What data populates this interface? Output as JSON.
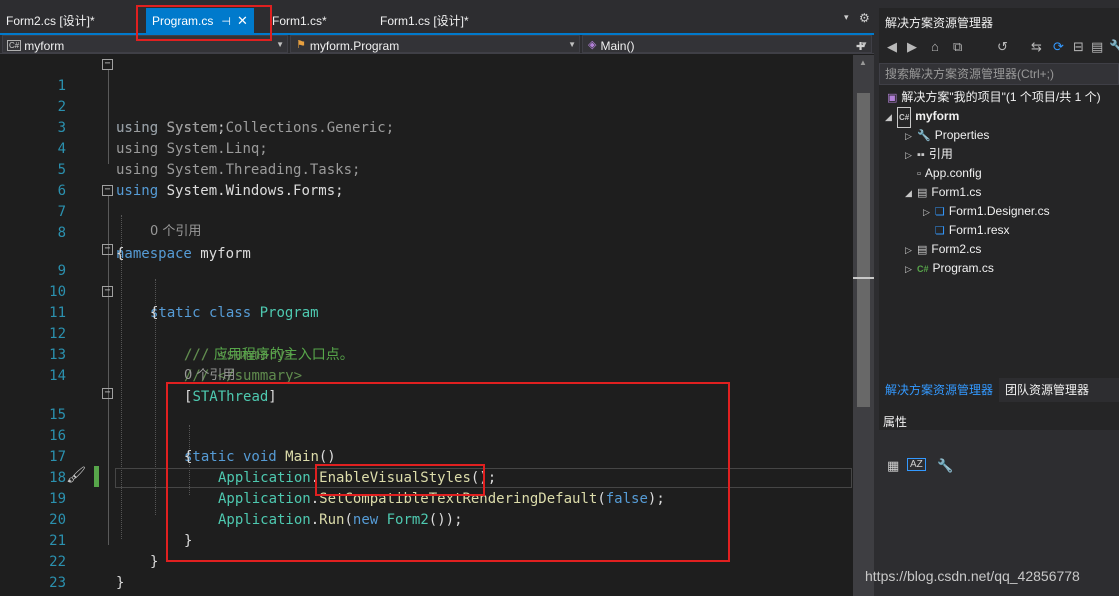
{
  "tabs": {
    "tab1": "Form2.cs [设计]*",
    "tab2": "Program.cs",
    "tab2_pin": "⊣",
    "tab2_close": "✕",
    "tab3": "Form1.cs*",
    "tab4": "Form1.cs [设计]*",
    "dropdown_icon": "▾",
    "gear_icon": "⚙"
  },
  "navbar": {
    "project": "myform",
    "project_badge": "C#",
    "class": "myform.Program",
    "member": "Main()"
  },
  "code": {
    "ln": [
      "1",
      "2",
      "3",
      "4",
      "5",
      "6",
      "7",
      "8",
      "9",
      "10",
      "11",
      "12",
      "13",
      "14",
      "15",
      "16",
      "17",
      "18",
      "19",
      "20",
      "21",
      "22",
      "23"
    ],
    "line1": {
      "kw": "using",
      "rest": " System;"
    },
    "line2": {
      "kw": "using",
      "rest": " System.Collections.Generic;"
    },
    "line3": {
      "kw": "using",
      "rest": " System.Linq;"
    },
    "line4": {
      "kw": "using",
      "rest": " System.Threading.Tasks;"
    },
    "line5": {
      "kw": "using",
      "rest": " System.Windows.Forms;"
    },
    "line7": {
      "kw": "namespace",
      "rest": " myform"
    },
    "line8": "{",
    "codelens1": "0 个引用",
    "line9": {
      "kw": "static class",
      "type": "Program"
    },
    "line10": "{",
    "line11": {
      "slashes": "///",
      "tag": " <summary>"
    },
    "line12": {
      "slashes": "///",
      "text": " 应用程序的主入口点。"
    },
    "line13": {
      "slashes": "///",
      "tag": " </summary>"
    },
    "line14": {
      "open": "[",
      "attr": "STAThread",
      "close": "]"
    },
    "codelens2": "0 个引用",
    "line15": {
      "kw": "static void",
      "fn": "Main",
      "rest": "()"
    },
    "line16": "{",
    "line17": {
      "type": "Application",
      "dot": ".",
      "fn": "EnableVisualStyles",
      "rest": "();"
    },
    "line18": {
      "type": "Application",
      "dot": ".",
      "fn": "SetCompatibleTextRenderingDefault",
      "open": "(",
      "kw": "false",
      "rest": ");"
    },
    "line19": {
      "type": "Application",
      "dot": ".",
      "fn": "Run",
      "open": "(",
      "kw": "new",
      "type2": "Form2",
      "rest": "());"
    },
    "line20": "}",
    "line21": "}",
    "line22": "}",
    "fold_minus": "−"
  },
  "scrollbar": {
    "up_arrow": "▲",
    "splitter": "✚"
  },
  "solution_explorer": {
    "title": "解决方案资源管理器",
    "search_placeholder": "搜索解决方案资源管理器(Ctrl+;)",
    "toolbar_icons": [
      "back-icon",
      "forward-icon",
      "home-icon",
      "switch-views-icon",
      "history-icon",
      "sync-icon",
      "refresh-icon",
      "collapse-icon",
      "show-all-files-icon",
      "properties-icon"
    ],
    "items": [
      {
        "label": "解决方案\"我的项目\"(1 个项目/共 1 个)"
      },
      {
        "label": "myform"
      },
      {
        "label": "Properties"
      },
      {
        "label": "引用"
      },
      {
        "label": "App.config"
      },
      {
        "label": "Form1.cs"
      },
      {
        "label": "Form1.Designer.cs"
      },
      {
        "label": "Form1.resx"
      },
      {
        "label": "Form2.cs"
      },
      {
        "label": "Program.cs"
      }
    ],
    "tab_solution": "解决方案资源管理器",
    "tab_team": "团队资源管理器"
  },
  "properties": {
    "title": "属性"
  },
  "watermark": "https://blog.csdn.net/qq_42856778"
}
